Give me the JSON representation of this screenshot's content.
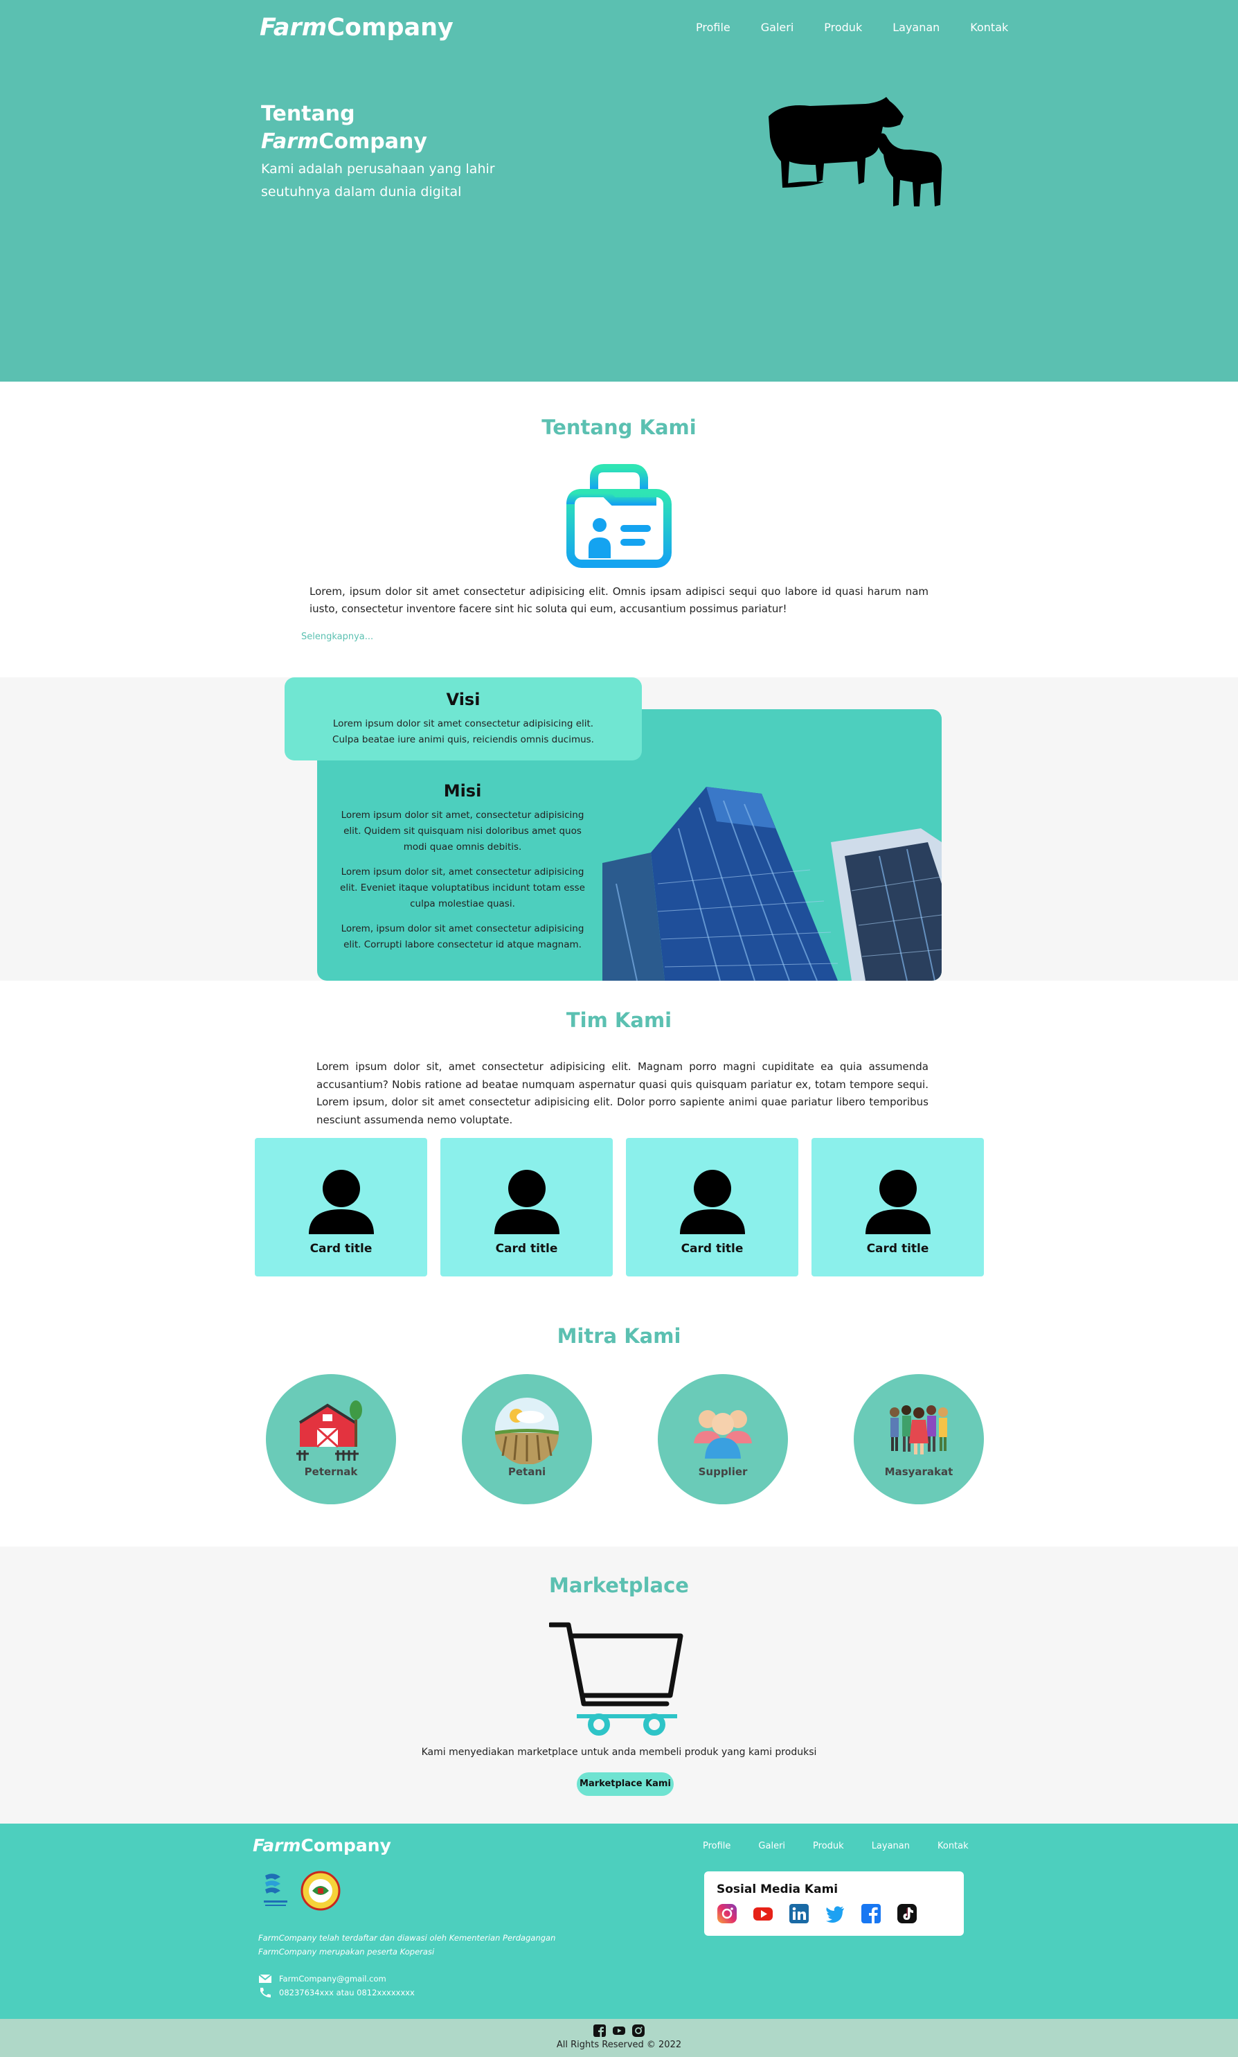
{
  "header": {
    "brand_italic": "Farm",
    "brand_rest": "Company",
    "nav": [
      "Profile",
      "Galeri",
      "Produk",
      "Layanan",
      "Kontak"
    ]
  },
  "hero": {
    "title_line1": "Tentang",
    "title_italic": "Farm",
    "title_rest": "Company",
    "subtitle": "Kami adalah perusahaan yang lahir seutuhnya dalam dunia digital"
  },
  "about": {
    "title": "Tentang Kami",
    "text": "Lorem, ipsum dolor sit amet consectetur adipisicing elit. Omnis ipsam adipisci sequi quo labore id quasi harum nam iusto, consectetur inventore facere sint hic soluta qui eum, accusantium possimus pariatur!",
    "more": "Selengkapnya..."
  },
  "visi": {
    "title": "Visi",
    "text": "Lorem ipsum dolor sit amet consectetur adipisicing elit. Culpa beatae iure animi quis, reiciendis omnis ducimus."
  },
  "misi": {
    "title": "Misi",
    "items": [
      "Lorem ipsum dolor sit amet, consectetur adipisicing elit. Quidem sit quisquam nisi doloribus amet quos modi quae omnis debitis.",
      "Lorem ipsum dolor sit, amet consectetur adipisicing elit. Eveniet itaque voluptatibus incidunt totam esse culpa molestiae quasi.",
      "Lorem, ipsum dolor sit amet consectetur adipisicing elit. Corrupti labore consectetur id atque magnam."
    ]
  },
  "team": {
    "title": "Tim Kami",
    "text": "Lorem ipsum dolor sit, amet consectetur adipisicing elit. Magnam porro magni cupiditate ea quia assumenda accusantium? Nobis ratione ad beatae numquam aspernatur quasi quis quisquam pariatur ex, totam tempore sequi. Lorem ipsum, dolor sit amet consectetur adipisicing elit. Dolor porro sapiente animi quae pariatur libero temporibus nesciunt assumenda nemo voluptate.",
    "cards": [
      "Card title",
      "Card title",
      "Card title",
      "Card title"
    ]
  },
  "mitra": {
    "title": "Mitra Kami",
    "items": [
      "Peternak",
      "Petani",
      "Supplier",
      "Masyarakat"
    ]
  },
  "marketplace": {
    "title": "Marketplace",
    "text": "Kami menyediakan marketplace untuk anda membeli produk yang kami produksi",
    "button": "Marketplace Kami"
  },
  "footer": {
    "brand_italic": "Farm",
    "brand_rest": "Company",
    "nav": [
      "Profile",
      "Galeri",
      "Produk",
      "Layanan",
      "Kontak"
    ],
    "desc_line1": "FarmCompany telah terdaftar dan diawasi oleh Kementerian Perdagangan",
    "desc_line2": "FarmCompany merupakan peserta Koperasi",
    "email": "FarmCompany@gmail.com",
    "phone": "08237634xxx atau 0812xxxxxxxx",
    "social_title": "Sosial Media Kami",
    "social_icons": [
      "instagram-icon",
      "youtube-icon",
      "linkedin-icon",
      "twitter-icon",
      "facebook-icon",
      "tiktok-icon"
    ],
    "copyright": "All Rights Reserved © 2022"
  },
  "colors": {
    "primary": "#5bc0b1",
    "teal_dark": "#4dcfbe",
    "card": "#8bf0eb",
    "visi": "#70e6d2"
  }
}
